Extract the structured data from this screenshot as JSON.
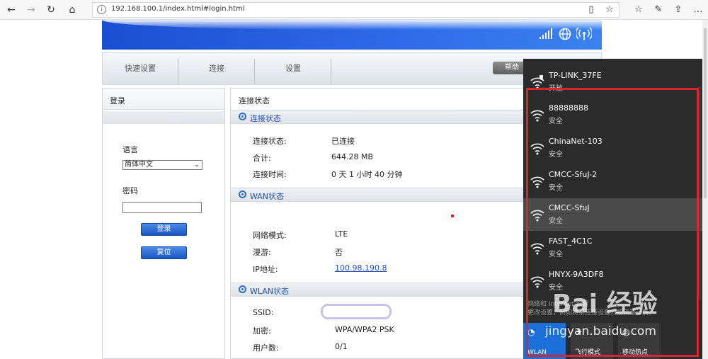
{
  "browser": {
    "url": "192.168.100.1/index.html#login.html",
    "icons": [
      "back-icon",
      "forward-icon",
      "refresh-icon",
      "home-icon",
      "info-icon",
      "reading-view-icon",
      "favorite-icon",
      "favorites-list-icon",
      "pen-icon",
      "share-icon",
      "more-icon"
    ]
  },
  "tabs": [
    {
      "label": "快速设置"
    },
    {
      "label": "连接"
    },
    {
      "label": "设置"
    }
  ],
  "help_label": "帮助",
  "login": {
    "title": "登录",
    "language_label": "语言",
    "language_value": "简体中文",
    "password_label": "密码",
    "login_button": "登录",
    "reset_button": "复位"
  },
  "status": {
    "title": "连接状态",
    "sections": {
      "conn": {
        "title": "连接状态"
      },
      "wan": {
        "title": "WAN状态"
      },
      "wlan": {
        "title": "WLAN状态"
      }
    },
    "conn_rows": [
      {
        "k": "连接状态:",
        "v": "已连接"
      },
      {
        "k": "合计:",
        "v": "644.28 MB"
      },
      {
        "k": "连接时间:",
        "v": "0 天 1 小时 40 分钟"
      }
    ],
    "wan_rows": [
      {
        "k": "网络模式:",
        "v": "LTE"
      },
      {
        "k": "漫游:",
        "v": "否"
      },
      {
        "k": "IP地址:",
        "v": "100.98.190.8"
      }
    ],
    "wlan_rows": [
      {
        "k": "SSID:",
        "v": ""
      },
      {
        "k": "加密:",
        "v": "WPA/WPA2 PSK"
      },
      {
        "k": "用户数:",
        "v": "0/1"
      }
    ]
  },
  "wifi": {
    "networks": [
      {
        "name": "TP-LINK_37FE",
        "status": "开放"
      },
      {
        "name": "88888888",
        "status": "安全"
      },
      {
        "name": "ChinaNet-103",
        "status": "安全"
      },
      {
        "name": "CMCC-SfuJ-2",
        "status": "安全"
      },
      {
        "name": "CMCC-SfuJ",
        "status": "安全"
      },
      {
        "name": "FAST_4C1C",
        "status": "安全"
      },
      {
        "name": "HNYX-9A3DF8",
        "status": "安全"
      }
    ],
    "footer_line1": "网络和 Internet 设置",
    "footer_line2": "更改设置，例如将某连接设置为按流量计费。",
    "quick_actions": [
      {
        "label": "WLAN"
      },
      {
        "label": "飞行模式"
      },
      {
        "label": "移动热点"
      }
    ]
  },
  "watermark": {
    "big": "Bai 经验",
    "small": "jingyan.baidu.com"
  },
  "colors": {
    "accent": "#1b55c4",
    "highlight_box": "#d9262c",
    "flyout_bg": "#2b2b2b",
    "wlan_active": "#1b6fd8"
  }
}
